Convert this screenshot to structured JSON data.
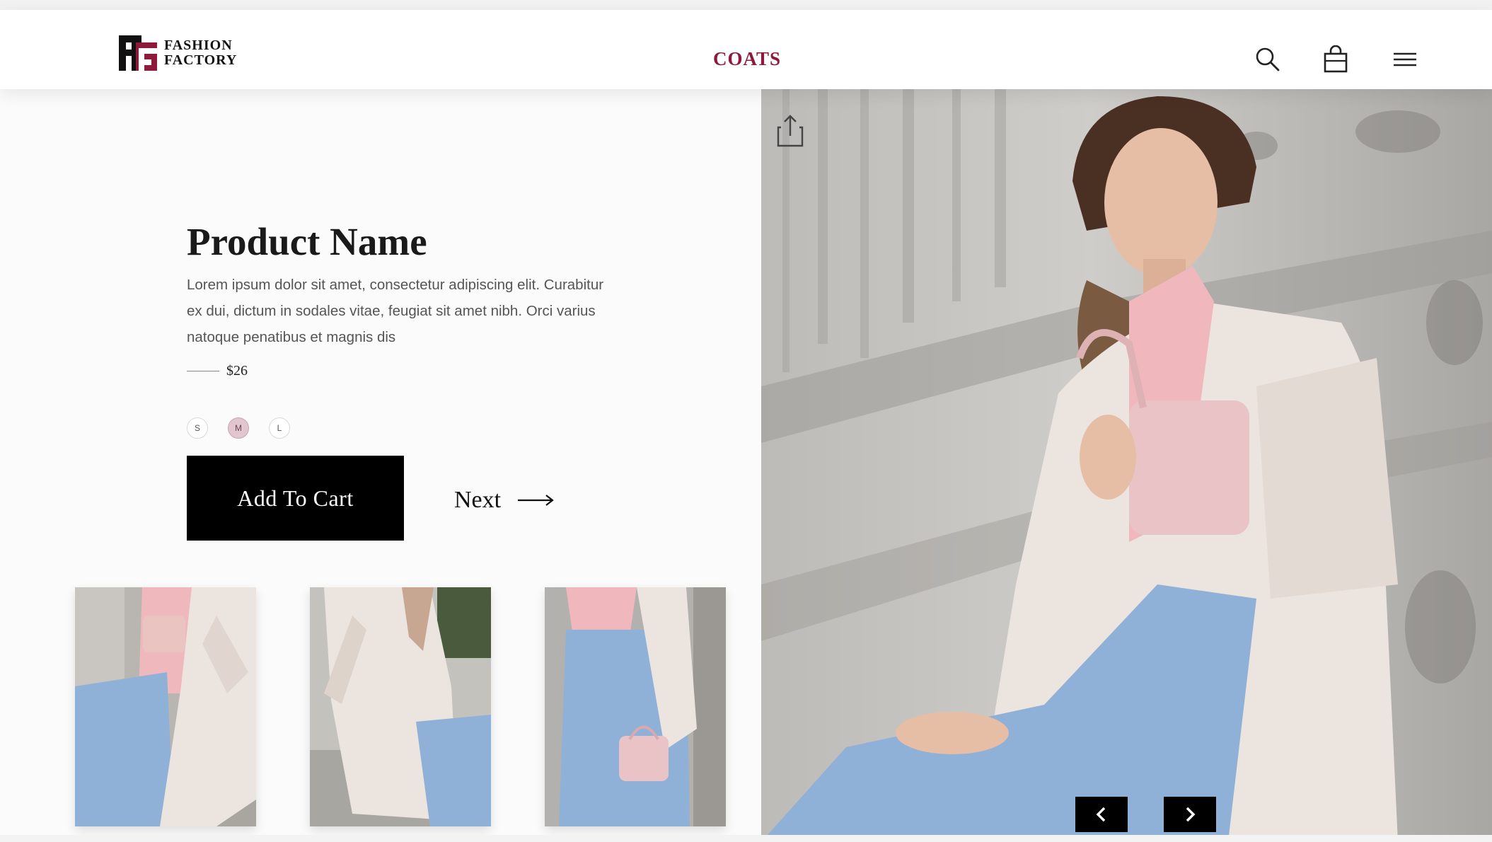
{
  "brand": {
    "line1": "FASHION",
    "line2": "FACTORY",
    "color": "#8d1a3b"
  },
  "nav": {
    "category": "COATS"
  },
  "header_icons": [
    "search-icon",
    "shopping-bag-icon",
    "hamburger-menu-icon"
  ],
  "product": {
    "name": "Product Name",
    "description": "Lorem ipsum dolor sit amet, consectetur adipiscing elit. Curabitur ex dui, dictum in sodales vitae, feugiat sit amet nibh. Orci varius natoque penatibus et magnis dis",
    "price": "$26",
    "sizes": [
      {
        "label": "S",
        "selected": false
      },
      {
        "label": "M",
        "selected": true
      },
      {
        "label": "L",
        "selected": false
      }
    ],
    "add_to_cart_label": "Add To Cart",
    "next_label": "Next"
  },
  "colors": {
    "accent": "#8d1a3b",
    "button": "#000000",
    "selected_size": "#e2c6cf",
    "coat": "#ece4de",
    "shirt": "#f0b7bd",
    "jeans": "#8fb1d8"
  }
}
